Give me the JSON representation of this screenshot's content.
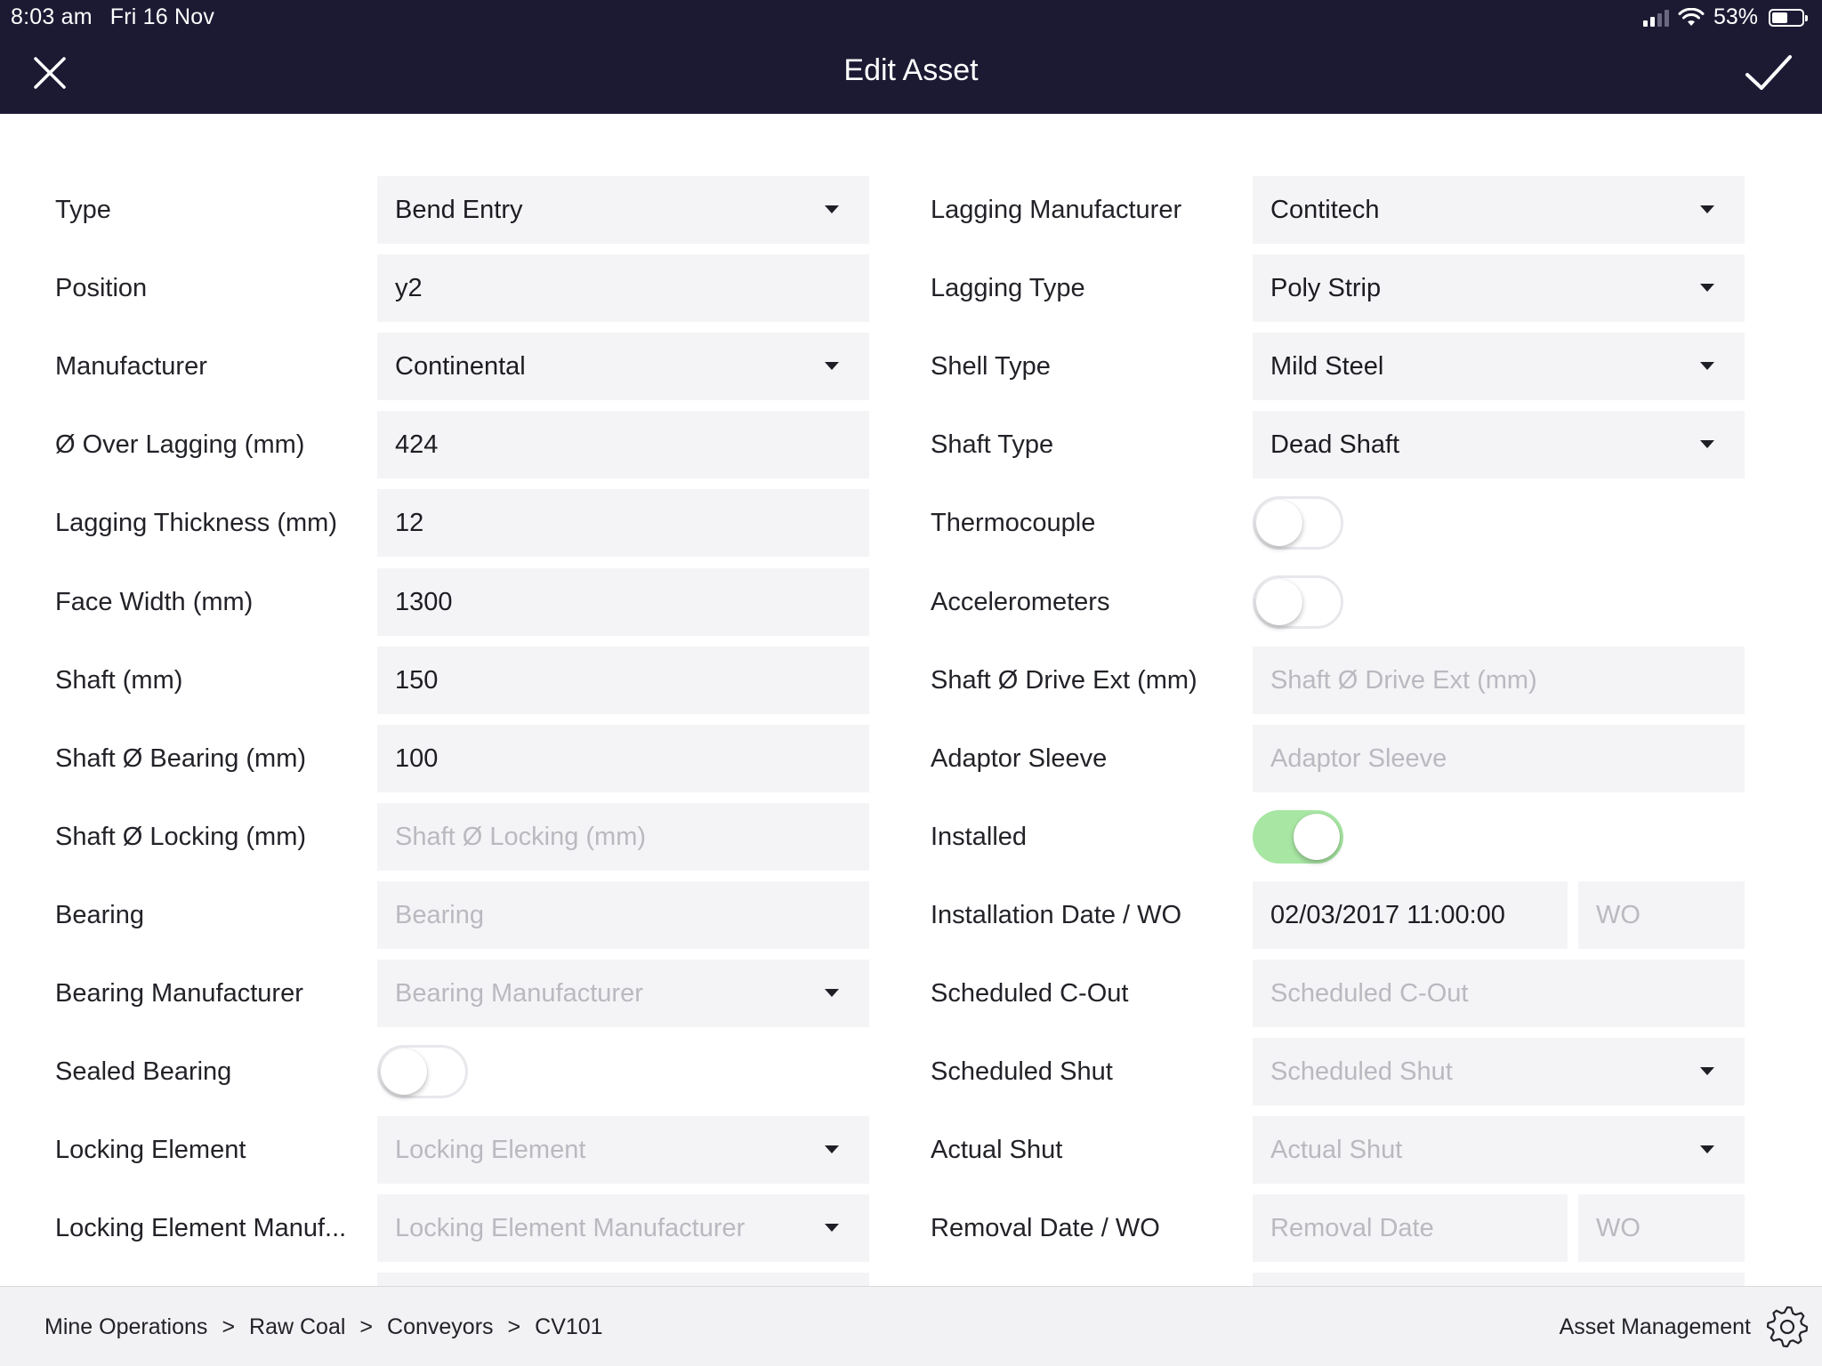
{
  "status_bar": {
    "time": "8:03 am",
    "date": "Fri 16 Nov",
    "battery_percent": "53%",
    "battery_level": 0.53
  },
  "header": {
    "title": "Edit Asset",
    "close_icon": "close-icon",
    "confirm_icon": "checkmark-icon"
  },
  "left_fields": [
    {
      "label": "Type",
      "kind": "dropdown",
      "value": "Bend Entry"
    },
    {
      "label": "Position",
      "kind": "text",
      "value": "y2"
    },
    {
      "label": "Manufacturer",
      "kind": "dropdown",
      "value": "Continental"
    },
    {
      "label": "Ø Over Lagging (mm)",
      "kind": "text",
      "value": "424"
    },
    {
      "label": "Lagging Thickness (mm)",
      "kind": "text",
      "value": "12"
    },
    {
      "label": "Face Width (mm)",
      "kind": "text",
      "value": "1300"
    },
    {
      "label": "Shaft (mm)",
      "kind": "text",
      "value": "150"
    },
    {
      "label": "Shaft Ø Bearing (mm)",
      "kind": "text",
      "value": "100"
    },
    {
      "label": "Shaft Ø Locking (mm)",
      "kind": "text",
      "value": "",
      "placeholder": "Shaft Ø Locking (mm)"
    },
    {
      "label": "Bearing",
      "kind": "text",
      "value": "",
      "placeholder": "Bearing"
    },
    {
      "label": "Bearing Manufacturer",
      "kind": "dropdown",
      "value": "",
      "placeholder": "Bearing Manufacturer"
    },
    {
      "label": "Sealed Bearing",
      "kind": "toggle",
      "on": false
    },
    {
      "label": "Locking Element",
      "kind": "dropdown",
      "value": "",
      "placeholder": "Locking Element"
    },
    {
      "label": "Locking Element Manuf...",
      "kind": "dropdown",
      "value": "",
      "placeholder": "Locking Element Manufacturer"
    }
  ],
  "right_fields": [
    {
      "label": "Lagging Manufacturer",
      "kind": "dropdown",
      "value": "Contitech"
    },
    {
      "label": "Lagging Type",
      "kind": "dropdown",
      "value": "Poly Strip"
    },
    {
      "label": "Shell Type",
      "kind": "dropdown",
      "value": "Mild Steel"
    },
    {
      "label": "Shaft Type",
      "kind": "dropdown",
      "value": "Dead Shaft"
    },
    {
      "label": "Thermocouple",
      "kind": "toggle",
      "on": false
    },
    {
      "label": "Accelerometers",
      "kind": "toggle",
      "on": false
    },
    {
      "label": "Shaft Ø Drive Ext (mm)",
      "kind": "text",
      "value": "",
      "placeholder": "Shaft Ø Drive Ext (mm)"
    },
    {
      "label": "Adaptor Sleeve",
      "kind": "text",
      "value": "",
      "placeholder": "Adaptor Sleeve"
    },
    {
      "label": "Installed",
      "kind": "toggle",
      "on": true
    },
    {
      "label": "Installation Date / WO",
      "kind": "pair",
      "value": "02/03/2017 11:00:00",
      "placeholder": "",
      "wo_value": "",
      "wo_placeholder": "WO"
    },
    {
      "label": "Scheduled C-Out",
      "kind": "text",
      "value": "",
      "placeholder": "Scheduled C-Out"
    },
    {
      "label": "Scheduled Shut",
      "kind": "dropdown",
      "value": "",
      "placeholder": "Scheduled Shut"
    },
    {
      "label": "Actual Shut",
      "kind": "dropdown",
      "value": "",
      "placeholder": "Actual Shut"
    },
    {
      "label": "Removal Date / WO",
      "kind": "pair",
      "value": "",
      "placeholder": "Removal Date",
      "wo_value": "",
      "wo_placeholder": "WO"
    }
  ],
  "footer": {
    "breadcrumb": [
      "Mine Operations",
      "Raw Coal",
      "Conveyors",
      "CV101"
    ],
    "separator": ">",
    "app_name": "Asset Management",
    "settings_icon": "gear-icon"
  },
  "colors": {
    "header_bg": "#1c1a33",
    "field_bg": "#f4f4f6",
    "toggle_on": "#a8e6a3",
    "placeholder": "#b9b9c0",
    "footer_bg": "#f2f2f4"
  }
}
